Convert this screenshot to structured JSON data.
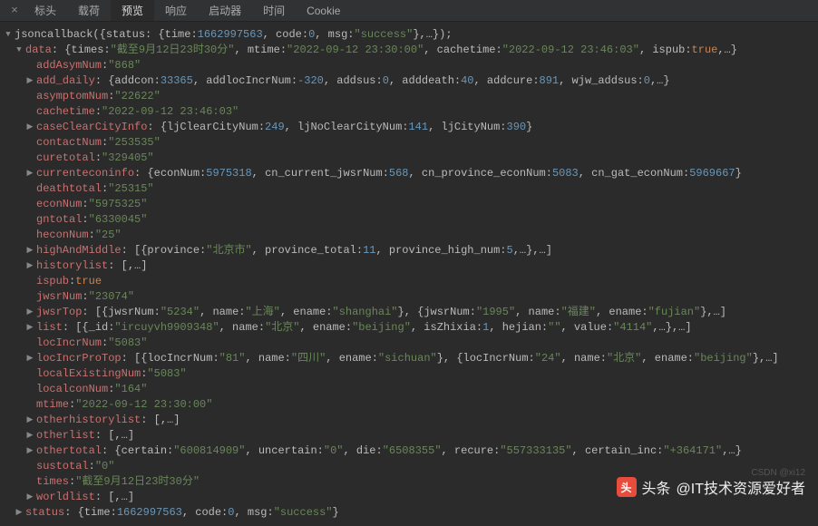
{
  "tabs": {
    "close": "×",
    "items": [
      "标头",
      "载荷",
      "预览",
      "响应",
      "启动器",
      "时间",
      "Cookie"
    ],
    "active": 2
  },
  "line_cb": {
    "fn": "jsoncallback",
    "status_time": "1662997563",
    "code": "0",
    "msg": "\"success\""
  },
  "data_line": {
    "times": "\"截至9月12日23时30分\"",
    "mtime": "\"2022-09-12 23:30:00\"",
    "cachetime": "\"2022-09-12 23:46:03\"",
    "ispub": "true"
  },
  "addAsymNum": "\"868\"",
  "add_daily": {
    "addcon": "33365",
    "addlocIncrNum": "-320",
    "addsus": "0",
    "adddeath": "40",
    "addcure": "891",
    "wjw_addsus": "0"
  },
  "asymptomNum": "\"22622\"",
  "cachetime": "\"2022-09-12 23:46:03\"",
  "caseClearCityInfo": {
    "ljClearCityNum": "249",
    "ljNoClearCityNum": "141",
    "ljCityNum": "390"
  },
  "contactNum": "\"253535\"",
  "curetotal": "\"329405\"",
  "currenteconinfo": {
    "econNum": "5975318",
    "cn_current_jwsrNum": "568",
    "cn_province_econNum": "5083",
    "cn_gat_econNum": "5969667"
  },
  "deathtotal": "\"25315\"",
  "econNum": "\"5975325\"",
  "gntotal": "\"6330045\"",
  "heconNum": "\"25\"",
  "highAndMiddle": {
    "province": "\"北京市\"",
    "province_total": "11",
    "province_high_num": "5"
  },
  "ispub": "true",
  "jwsrNum": "\"23074\"",
  "jwsrTop": {
    "a_num": "\"5234\"",
    "a_name": "\"上海\"",
    "a_ename": "\"shanghai\"",
    "b_num": "\"1995\"",
    "b_name": "\"福建\"",
    "b_ename": "\"fujian\""
  },
  "list": {
    "id": "\"ircuyvh9909348\"",
    "name": "\"北京\"",
    "ename": "\"beijing\"",
    "isZhixia": "1",
    "hejian": "\"\"",
    "value": "\"4114\""
  },
  "locIncrNum": "\"5083\"",
  "locIncrProTop": {
    "a_num": "\"81\"",
    "a_name": "\"四川\"",
    "a_ename": "\"sichuan\"",
    "b_num": "\"24\"",
    "b_name": "\"北京\"",
    "b_ename": "\"beijing\""
  },
  "localExistingNum": "\"5083\"",
  "localconNum": "\"164\"",
  "mtime": "\"2022-09-12 23:30:00\"",
  "othertotal": {
    "certain": "\"600814909\"",
    "uncertain": "\"0\"",
    "die": "\"6508355\"",
    "recure": "\"557333135\"",
    "certain_inc": "\"+364171\""
  },
  "sustotal": "\"0\"",
  "times": "\"截至9月12日23时30分\"",
  "status": {
    "time": "1662997563",
    "code": "0",
    "msg": "\"success\""
  },
  "labels": {
    "historylist": "historylist",
    "otherhistorylist": "otherhistorylist",
    "otherlist": "otherlist",
    "worldlist": "worldlist",
    "data": "data",
    "status": "status",
    "addAsymNum": "addAsymNum",
    "add_daily": "add_daily",
    "asymptomNum": "asymptomNum",
    "cachetime": "cachetime",
    "caseClearCityInfo": "caseClearCityInfo",
    "contactNum": "contactNum",
    "curetotal": "curetotal",
    "currenteconinfo": "currenteconinfo",
    "deathtotal": "deathtotal",
    "econNum": "econNum",
    "gntotal": "gntotal",
    "heconNum": "heconNum",
    "highAndMiddle": "highAndMiddle",
    "ispub": "ispub",
    "jwsrNum": "jwsrNum",
    "jwsrTop": "jwsrTop",
    "list": "list",
    "locIncrNum": "locIncrNum",
    "locIncrProTop": "locIncrProTop",
    "localExistingNum": "localExistingNum",
    "localconNum": "localconNum",
    "mtime": "mtime",
    "othertotal": "othertotal",
    "sustotal": "sustotal",
    "times": "times",
    "worldlist2": "worldlist"
  },
  "watermark": {
    "brand": "头条",
    "handle": "@IT技术资源爱好者",
    "csdn": "CSDN @xi12"
  }
}
